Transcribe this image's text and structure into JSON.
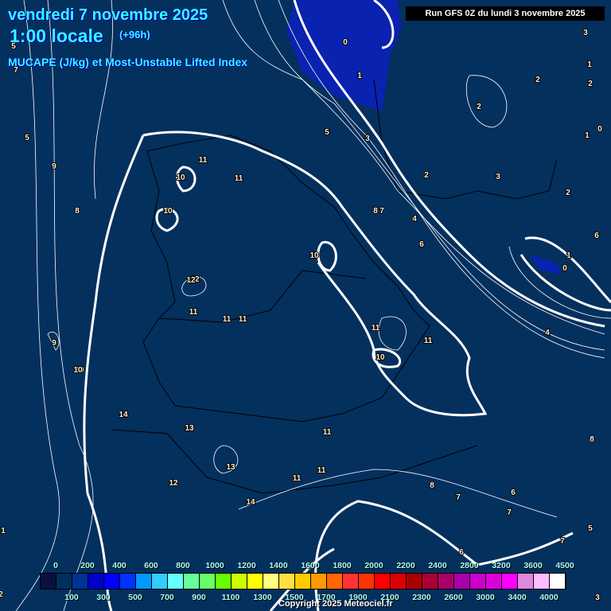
{
  "header": {
    "date": "vendredi 7 novembre 2025",
    "time": "1:00 locale",
    "lead": "(+96h)",
    "parameter": "MUCAPE (J/kg) et Most-Unstable Lifted Index",
    "run": "Run GFS 0Z du lundi 3 novembre 2025"
  },
  "legend": {
    "top_labels": [
      "0",
      "200",
      "400",
      "600",
      "800",
      "1000",
      "1200",
      "1400",
      "1600",
      "1800",
      "2000",
      "2200",
      "2400",
      "2800",
      "3200",
      "3600",
      "4500"
    ],
    "bottom_labels": [
      "100",
      "300",
      "500",
      "700",
      "900",
      "1100",
      "1300",
      "1500",
      "1700",
      "1900",
      "2100",
      "2300",
      "2600",
      "3000",
      "3400",
      "4000"
    ],
    "colors": [
      "#0a1040",
      "#00305f",
      "#003399",
      "#0000cc",
      "#0000ff",
      "#0033ff",
      "#0099ff",
      "#33ccff",
      "#66ffff",
      "#66ff99",
      "#66ff66",
      "#66ff00",
      "#ccff00",
      "#ffff00",
      "#ffff80",
      "#ffe040",
      "#ffcc00",
      "#ff9900",
      "#ff6600",
      "#ff3333",
      "#ff3300",
      "#ff0000",
      "#dd0000",
      "#aa0000",
      "#aa0033",
      "#aa0066",
      "#aa00aa",
      "#cc00cc",
      "#dd00dd",
      "#ff00ff",
      "#dd88dd",
      "#ffbbff",
      "#ffffff"
    ]
  },
  "contour_labels": [
    "0",
    "1",
    "3",
    "5",
    "2",
    "2",
    "2",
    "1",
    "1",
    "0",
    "1",
    "3",
    "2",
    "2",
    "4",
    "5",
    "6",
    "8",
    "7",
    "11",
    "10",
    "9",
    "10",
    "11",
    "8",
    "7",
    "6",
    "5",
    "4",
    "10",
    "10",
    "12",
    "11",
    "11",
    "11",
    "11",
    "10",
    "11",
    "14",
    "13",
    "13",
    "12",
    "14",
    "11",
    "11",
    "8",
    "7",
    "6",
    "7",
    "6",
    "7",
    "5",
    "3",
    "0",
    "1",
    "2",
    "9",
    "10",
    "11",
    "3",
    "8",
    "12"
  ],
  "copyright": "Copyright 2025 Meteociel.fr"
}
